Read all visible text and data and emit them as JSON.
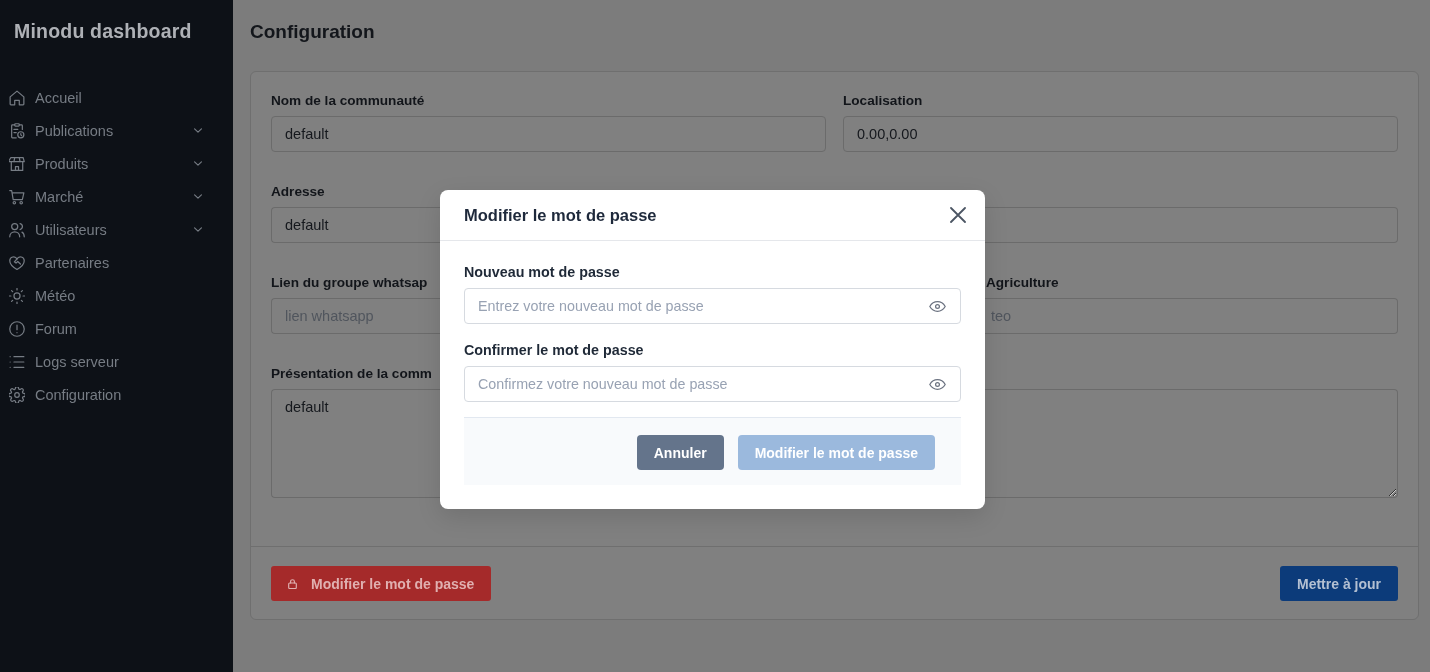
{
  "sidebar": {
    "title": "Minodu dashboard",
    "items": [
      {
        "label": "Accueil",
        "kind": "link",
        "selected": false
      },
      {
        "label": "Publications",
        "kind": "group",
        "selected": false,
        "expanded": false
      },
      {
        "label": "Produits",
        "kind": "group",
        "selected": false,
        "expanded": false
      },
      {
        "label": "Marché",
        "kind": "group",
        "selected": false,
        "expanded": false
      },
      {
        "label": "Utilisateurs",
        "kind": "group",
        "selected": false,
        "expanded": false
      },
      {
        "label": "Partenaires",
        "kind": "link",
        "selected": false
      },
      {
        "label": "Météo",
        "kind": "link",
        "selected": false
      },
      {
        "label": "Forum",
        "kind": "link",
        "selected": false
      },
      {
        "label": "Logs serveur",
        "kind": "link",
        "selected": false
      },
      {
        "label": "Configuration",
        "kind": "link",
        "selected": false
      }
    ]
  },
  "page_title": "Configuration",
  "form": {
    "fields": [
      {
        "label": "Nom de la communauté",
        "kind": "input",
        "value": "default",
        "behind_dialog": false
      },
      {
        "label": "Localisation",
        "kind": "input",
        "value": "0.00,0.00",
        "behind_dialog": false
      },
      {
        "label": "Adresse",
        "kind": "input",
        "value": "default",
        "behind_dialog": true
      },
      {
        "kind": "input",
        "behind_dialog": true
      },
      {
        "label": "Lien du groupe whatsap",
        "kind": "input",
        "placeholder": "lien whatsapp",
        "behind_dialog": true
      },
      {
        "label": "Agriculture",
        "kind": "input",
        "placeholder": "teo",
        "behind_dialog": true
      },
      {
        "label": "Présentation de la comm",
        "kind": "textarea",
        "value": "default",
        "behind_dialog": true
      },
      {
        "kind": "textarea",
        "behind_dialog": true
      }
    ]
  },
  "actions": [
    {
      "label": "Modifier le mot de passe",
      "kind": "danger"
    },
    {
      "label": "Mettre à jour",
      "kind": "primary"
    }
  ],
  "dialog": {
    "title": "Modifier le mot de passe",
    "fields": [
      {
        "label": "Nouveau mot de passe",
        "placeholder": "Entrez votre nouveau mot de passe"
      },
      {
        "label": "Confirmer le mot de passe",
        "placeholder": "Confirmez votre nouveau mot de passe"
      }
    ],
    "buttons": [
      {
        "label": "Annuler",
        "kind": "secondary",
        "disabled": false
      },
      {
        "label": "Modifier le mot de passe",
        "kind": "primary",
        "disabled": true
      }
    ]
  }
}
